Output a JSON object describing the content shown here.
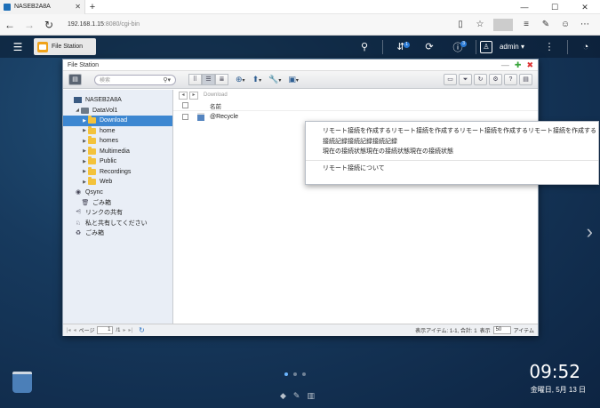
{
  "browser": {
    "tab_title": "NASEB2A8A",
    "tab_close": "✕",
    "new_tab": "+",
    "url_host": "192.168.1.15",
    "url_rest": ":8080/cgi-bin",
    "win_min": "—",
    "win_max": "☐",
    "win_close": "✕"
  },
  "topbar": {
    "app_tab_label": "File Station",
    "badge_tasks": "1",
    "badge_notifications": "3",
    "user": "admin ▾"
  },
  "window": {
    "title": "File Station",
    "search_placeholder": "検索"
  },
  "path": {
    "text": "Download"
  },
  "tree": [
    {
      "label": "NASEB2A8A",
      "indent": 0,
      "icon": "nas-icon",
      "caret": "",
      "selected": false
    },
    {
      "label": "DataVol1",
      "indent": 1,
      "icon": "drive-icon",
      "caret": "◢",
      "selected": false
    },
    {
      "label": "Download",
      "indent": 2,
      "icon": "folder-icon",
      "caret": "▶",
      "selected": true
    },
    {
      "label": "home",
      "indent": 2,
      "icon": "folder-icon",
      "caret": "▶",
      "selected": false
    },
    {
      "label": "homes",
      "indent": 2,
      "icon": "folder-icon",
      "caret": "▶",
      "selected": false
    },
    {
      "label": "Multimedia",
      "indent": 2,
      "icon": "folder-icon",
      "caret": "▶",
      "selected": false
    },
    {
      "label": "Public",
      "indent": 2,
      "icon": "folder-icon",
      "caret": "▶",
      "selected": false
    },
    {
      "label": "Recordings",
      "indent": 2,
      "icon": "folder-icon",
      "caret": "▶",
      "selected": false
    },
    {
      "label": "Web",
      "indent": 2,
      "icon": "folder-icon",
      "caret": "▶",
      "selected": false
    },
    {
      "label": "Qsync",
      "indent": 0,
      "icon": "qsync-icon",
      "caret": "",
      "selected": false
    },
    {
      "label": "ごみ箱",
      "indent": 1,
      "icon": "trash-icon",
      "caret": "",
      "selected": false
    },
    {
      "label": "リンクの共有",
      "indent": 0,
      "icon": "share-link-icon",
      "caret": "",
      "selected": false
    },
    {
      "label": "私と共有してください",
      "indent": 0,
      "icon": "shared-with-me-icon",
      "caret": "",
      "selected": false
    },
    {
      "label": "ごみ箱",
      "indent": 0,
      "icon": "recycle-icon",
      "caret": "",
      "selected": false
    }
  ],
  "file_list": {
    "column_name": "名前",
    "rows": [
      {
        "name": "@Recycle"
      }
    ]
  },
  "statusbar": {
    "page_label": "ページ",
    "page_value": "1",
    "page_total": "/1",
    "items_info": "表示アイテム: 1-1, 合計: 1",
    "display_label": "表示",
    "per_page": "50",
    "items_label": "アイテム"
  },
  "dropdown": {
    "items": [
      "リモート接続を作成するリモート接続を作成するリモート接続を作成するリモート接続を作成する",
      "接続記録接続記録接続記録",
      "現在の接続状態現在の接続状態現在の接続状態"
    ],
    "about": "リモート接続について"
  },
  "desktop": {
    "time": "09:52",
    "date": "金曜日, 5月 13 日"
  },
  "colors": {
    "selection": "#3d87d1",
    "accent": "#f0a31a"
  }
}
